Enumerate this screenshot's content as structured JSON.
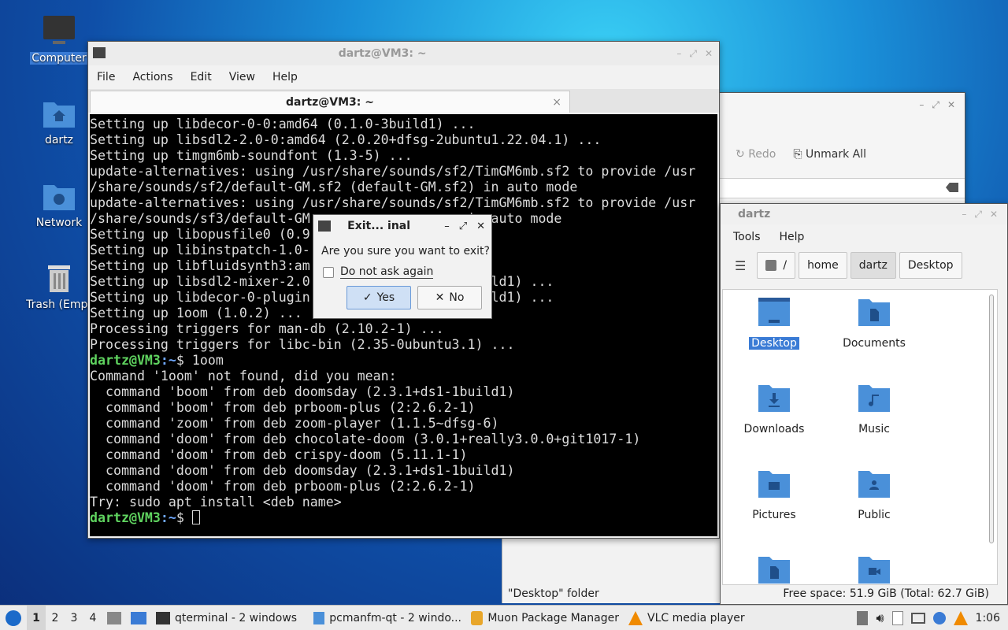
{
  "desktop": {
    "icons": [
      {
        "label": "Computer",
        "icon": "computer-icon"
      },
      {
        "label": "dartz",
        "icon": "home-folder-icon"
      },
      {
        "label": "Network",
        "icon": "network-folder-icon"
      },
      {
        "label": "Trash (Empt",
        "icon": "trash-icon"
      }
    ]
  },
  "terminal": {
    "title": "dartz@VM3: ~",
    "menu": [
      "File",
      "Actions",
      "Edit",
      "View",
      "Help"
    ],
    "tab_label": "dartz@VM3: ~",
    "tab_close": "×",
    "lines": [
      "Setting up libdecor-0-0:amd64 (0.1.0-3build1) ...",
      "Setting up libsdl2-2.0-0:amd64 (2.0.20+dfsg-2ubuntu1.22.04.1) ...",
      "Setting up timgm6mb-soundfont (1.3-5) ...",
      "update-alternatives: using /usr/share/sounds/sf2/TimGM6mb.sf2 to provide /usr",
      "/share/sounds/sf2/default-GM.sf2 (default-GM.sf2) in auto mode",
      "update-alternatives: using /usr/share/sounds/sf2/TimGM6mb.sf2 to provide /usr",
      "/share/sounds/sf3/default-GM                    in auto mode",
      "Setting up libopusfile0 (0.9.                   .",
      "Setting up libinstpatch-1.0-",
      "Setting up libfluidsynth3:am",
      "Setting up libsdl2-mixer-2.0                    build1) ...",
      "Setting up libdecor-0-plugin                    build1) ...",
      "Setting up 1oom (1.0.2) ...",
      "Processing triggers for man-db (2.10.2-1) ...",
      "Processing triggers for libc-bin (2.35-0ubuntu3.1) ..."
    ],
    "prompt_user": "dartz@VM3",
    "prompt_path": ":~",
    "prompt_sym": "$ ",
    "command": "1oom",
    "output": [
      "Command '1oom' not found, did you mean:",
      "  command 'boom' from deb doomsday (2.3.1+ds1-1build1)",
      "  command 'boom' from deb prboom-plus (2:2.6.2-1)",
      "  command 'zoom' from deb zoom-player (1.1.5~dfsg-6)",
      "  command 'doom' from deb chocolate-doom (3.0.1+really3.0.0+git1017-1)",
      "  command 'doom' from deb crispy-doom (5.11.1-1)",
      "  command 'doom' from deb doomsday (2.3.1+ds1-1build1)",
      "  command 'doom' from deb prboom-plus (2:2.6.2-1)",
      "Try: sudo apt install <deb name>"
    ]
  },
  "dialog": {
    "title": "Exit... inal",
    "question": "Are you sure you want to exit?",
    "checkbox_label": "Do not ask again",
    "checked": false,
    "yes_label": "Yes",
    "no_label": "No"
  },
  "muon": {
    "redo_label": "Redo",
    "unmark_label": "Unmark All"
  },
  "filemanager": {
    "title": "dartz",
    "menu": [
      "Tools",
      "Help"
    ],
    "path": [
      "/",
      "home",
      "dartz",
      "Desktop"
    ],
    "items": [
      {
        "label": "Desktop",
        "icon": "desktop-folder-icon"
      },
      {
        "label": "Documents",
        "icon": "documents-folder-icon"
      },
      {
        "label": "Downloads",
        "icon": "downloads-folder-icon"
      },
      {
        "label": "Music",
        "icon": "music-folder-icon"
      },
      {
        "label": "Pictures",
        "icon": "pictures-folder-icon"
      },
      {
        "label": "Public",
        "icon": "public-folder-icon"
      },
      {
        "label": "",
        "icon": "templates-folder-icon"
      },
      {
        "label": "",
        "icon": "videos-folder-icon"
      }
    ],
    "status_left": "\"Desktop\" folder",
    "status_right": "Free space: 51.9 GiB (Total: 62.7 GiB)"
  },
  "taskbar": {
    "workspaces": [
      "1",
      "2",
      "3",
      "4"
    ],
    "tasks": [
      {
        "label": "qterminal - 2 windows",
        "icon": "terminal-icon"
      },
      {
        "label": "pcmanfm-qt - 2 windo...",
        "icon": "folder-icon"
      },
      {
        "label": "Muon Package Manager",
        "icon": "package-icon"
      },
      {
        "label": "VLC media player",
        "icon": "vlc-cone-icon"
      }
    ],
    "clock": "1:06"
  },
  "colors": {
    "accent": "#3a7bd5",
    "folder": "#4a90d9",
    "prompt_user": "#5fd35f",
    "prompt_path": "#6fa8ff"
  }
}
